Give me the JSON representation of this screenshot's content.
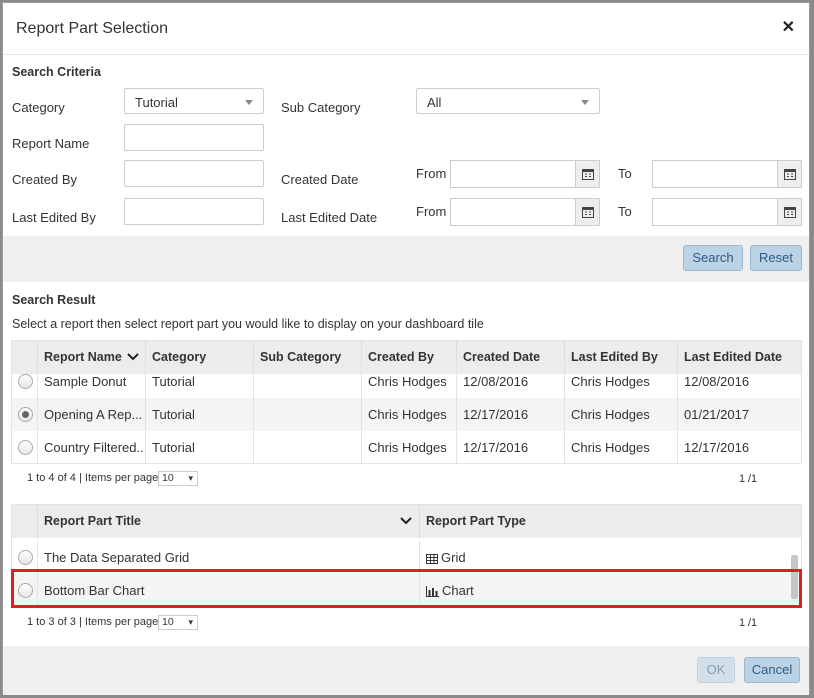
{
  "dialog": {
    "title": "Report Part Selection"
  },
  "criteria": {
    "heading": "Search Criteria",
    "category_label": "Category",
    "category_value": "Tutorial",
    "subcategory_label": "Sub Category",
    "subcategory_value": "All",
    "report_name_label": "Report Name",
    "created_by_label": "Created By",
    "created_date_label": "Created Date",
    "last_edited_by_label": "Last Edited By",
    "last_edited_date_label": "Last Edited Date",
    "from_label": "From",
    "to_label": "To"
  },
  "actions": {
    "search": "Search",
    "reset": "Reset"
  },
  "result": {
    "heading": "Search Result",
    "instruction": "Select a report then select report part you would like to display on your dashboard tile",
    "columns": [
      "Report Name",
      "Category",
      "Sub Category",
      "Created By",
      "Created Date",
      "Last Edited By",
      "Last Edited Date"
    ],
    "rows": [
      [
        "Sample Donut",
        "Tutorial",
        "",
        "Chris Hodges",
        "12/08/2016",
        "Chris Hodges",
        "12/08/2016"
      ],
      [
        "Opening A Rep...",
        "Tutorial",
        "",
        "Chris Hodges",
        "12/17/2016",
        "Chris Hodges",
        "01/21/2017"
      ],
      [
        "Country Filtered...",
        "Tutorial",
        "",
        "Chris Hodges",
        "12/17/2016",
        "Chris Hodges",
        "12/17/2016"
      ]
    ],
    "pager_text": "1 to 4 of 4 | Items per page",
    "items_per_page": "10",
    "page_current": "1",
    "page_total": "/1"
  },
  "parts": {
    "columns": [
      "Report Part Title",
      "Report Part Type"
    ],
    "rows": [
      [
        "The Data Separated Grid",
        "Grid"
      ],
      [
        "Bottom Bar Chart",
        "Chart"
      ]
    ],
    "pager_text": "1 to 3 of 3 | Items per page",
    "items_per_page": "10",
    "page_current": "1",
    "page_total": "/1"
  },
  "footer": {
    "ok": "OK",
    "cancel": "Cancel"
  },
  "colors": {
    "highlight": "#e02020",
    "button_bg": "#bcd3e6",
    "button_text": "#2d5a85"
  }
}
